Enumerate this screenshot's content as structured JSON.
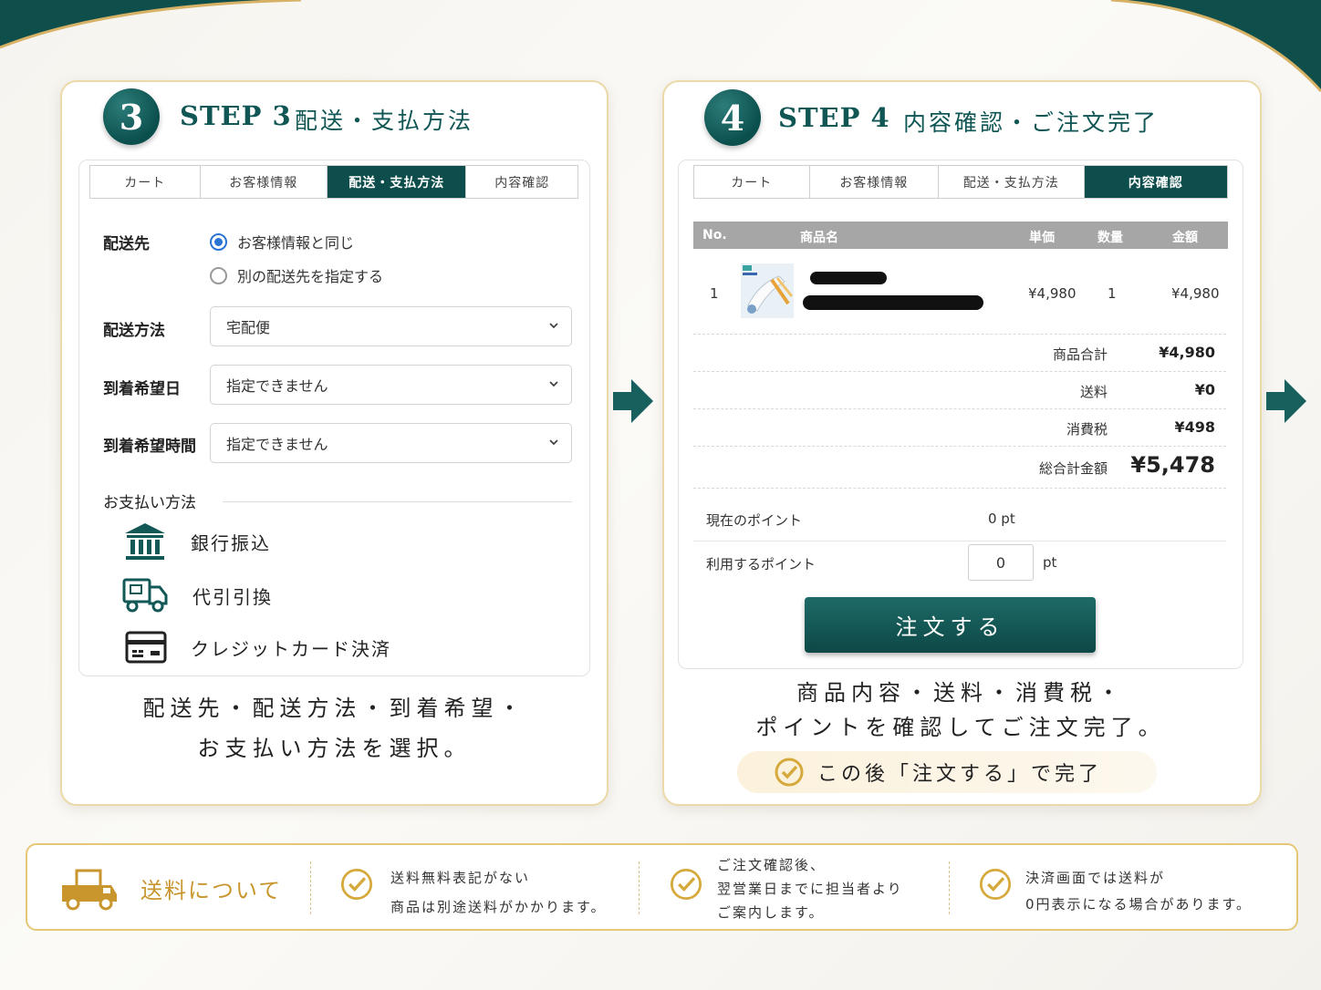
{
  "step3": {
    "number": "3",
    "title": "STEP 3",
    "subtitle": "配送・支払方法",
    "tabs": [
      "カート",
      "お客様情報",
      "配送・支払方法",
      "内容確認"
    ],
    "active_tab": 2,
    "shipping_dest_label": "配送先",
    "radio_same": "お客様情報と同じ",
    "radio_other": "別の配送先を指定する",
    "shipping_method_label": "配送方法",
    "shipping_method_value": "宅配便",
    "arrival_date_label": "到着希望日",
    "arrival_date_value": "指定できません",
    "arrival_time_label": "到着希望時間",
    "arrival_time_value": "指定できません",
    "payment_heading": "お支払い方法",
    "payments": [
      {
        "icon": "bank-icon",
        "label": "銀行振込"
      },
      {
        "icon": "delivery-truck-icon",
        "label": "代引引換"
      },
      {
        "icon": "credit-card-icon",
        "label": "クレジットカード決済"
      }
    ],
    "caption_line1": "配送先・配送方法・到着希望・",
    "caption_line2": "お支払い方法を選択。"
  },
  "step4": {
    "number": "4",
    "title": "STEP 4",
    "subtitle": "内容確認・ご注文完了",
    "tabs": [
      "カート",
      "お客様情報",
      "配送・支払方法",
      "内容確認"
    ],
    "active_tab": 3,
    "table_headers": {
      "no": "No.",
      "name": "商品名",
      "unit_price": "単価",
      "qty": "数量",
      "amount": "金額"
    },
    "item": {
      "no": "1",
      "unit_price": "¥4,980",
      "qty": "1",
      "amount": "¥4,980"
    },
    "subtotal_label": "商品合計",
    "subtotal_value": "¥4,980",
    "shipping_label": "送料",
    "shipping_value": "¥0",
    "tax_label": "消費税",
    "tax_value": "¥498",
    "total_label": "総合計金額",
    "total_value": "¥5,478",
    "current_points_label": "現在のポイント",
    "current_points_value": "0 pt",
    "use_points_label": "利用するポイント",
    "use_points_input": "0",
    "use_points_unit": "pt",
    "order_button": "注文する",
    "caption_line1": "商品内容・送料・消費税・",
    "caption_line2": "ポイントを確認してご注文完了。",
    "note": "この後「注文する」で完了"
  },
  "banner": {
    "title": "送料について",
    "notes": [
      [
        "送料無料表記がない",
        "商品は別途送料がかかります。"
      ],
      [
        "ご注文確認後、",
        "翌営業日までに担当者より",
        "ご案内します。"
      ],
      [
        "決済画面では送料が",
        "0円表示になる場合があります。"
      ]
    ]
  },
  "colors": {
    "teal": "#0d4e4c",
    "gold": "#d6a93c",
    "radio_blue": "#2a74d6"
  }
}
